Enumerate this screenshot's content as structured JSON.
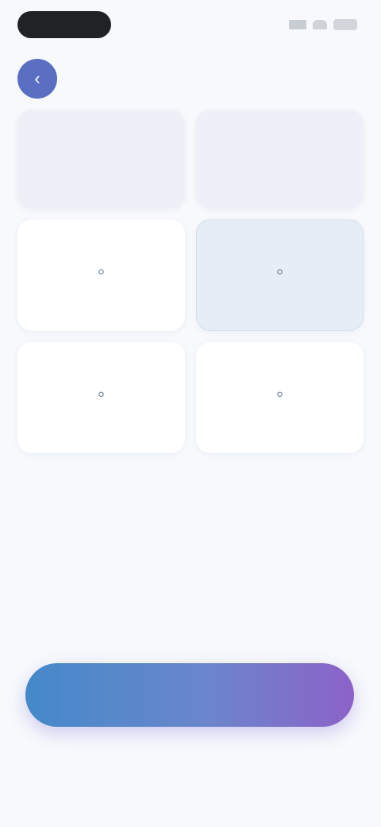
{
  "header": {
    "title": "",
    "back_icon": "chevron-left-icon"
  },
  "options": [
    {
      "label": "",
      "icon": "none"
    },
    {
      "label": "",
      "icon": "none"
    },
    {
      "label": "",
      "icon": "circle-icon"
    },
    {
      "label": "",
      "icon": "circle-icon"
    },
    {
      "label": "",
      "icon": "circle-icon"
    },
    {
      "label": "",
      "icon": "circle-icon"
    }
  ],
  "actions": {
    "continue_label": "",
    "skip_label": ""
  },
  "colors": {
    "accent_start": "#4489c9",
    "accent_end": "#8c62c8",
    "selected_bg": "#e7edf6"
  }
}
